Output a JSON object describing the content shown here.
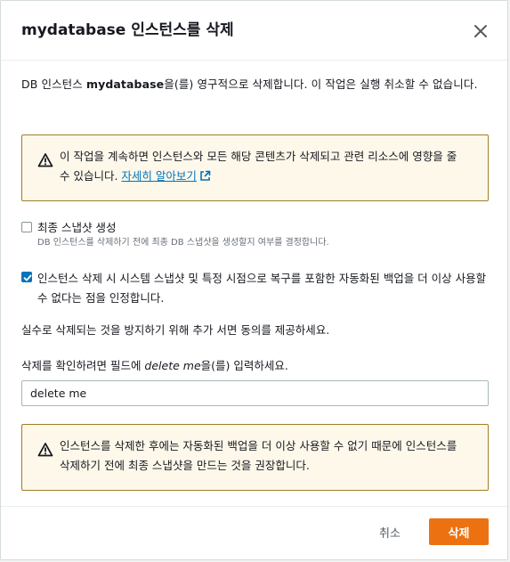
{
  "modal": {
    "title": "mydatabase 인스턴스를 삭제",
    "close_icon": "close-icon"
  },
  "description": {
    "prefix": "DB 인스턴스 ",
    "instance": "mydatabase",
    "suffix": "을(를) 영구적으로 삭제합니다. 이 작업은 실행 취소할 수 없습니다."
  },
  "alert_top": {
    "icon": "warning-icon",
    "text": "이 작업을 계속하면 인스턴스와 모든 해당 콘텐츠가 삭제되고 관련 리소스에 영향을 줄 수 있습니다. ",
    "link": "자세히 알아보기",
    "link_icon": "external-link-icon"
  },
  "final_snapshot": {
    "label": "최종 스냅샷 생성",
    "description": "DB 인스턴스를 삭제하기 전에 최종 DB 스냅샷을 생성할지 여부를 결정합니다.",
    "checked": false
  },
  "acknowledge_backups": {
    "label": "인스턴스 삭제 시 시스템 스냅샷 및 특정 시점으로 복구를 포함한 자동화된 백업을 더 이상 사용할 수 없다는 점을 인정합니다.",
    "checked": true
  },
  "acknowledge_text": "실수로 삭제되는 것을 방지하기 위해 추가 서면 동의를 제공하세요.",
  "confirm": {
    "label_prefix": "삭제를 확인하려면 필드에 ",
    "label_keyword": "delete me",
    "label_suffix": "을(를) 입력하세요.",
    "value": "delete me"
  },
  "alert_bottom": {
    "icon": "warning-icon",
    "text": "인스턴스를 삭제한 후에는 자동화된 백업을 더 이상 사용할 수 없기 때문에 인스턴스를 삭제하기 전에 최종 스냅샷을 만드는 것을 권장합니다."
  },
  "footer": {
    "cancel_label": "취소",
    "delete_label": "삭제"
  },
  "colors": {
    "primary_button": "#ec7211",
    "link": "#0073bb",
    "alert_border": "#a07e27",
    "alert_background": "#fef8eb"
  }
}
